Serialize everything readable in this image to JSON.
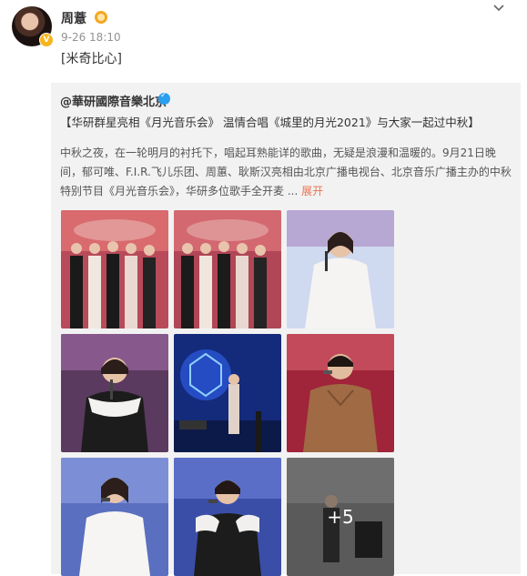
{
  "post": {
    "author": "周薏",
    "timestamp": "9-26 18:10",
    "text": "[米奇比心]"
  },
  "repost": {
    "author": "@華研國際音樂北京",
    "headline": "【华研群星亮相《月光音乐会》 温情合唱《城里的月光2021》与大家一起过中秋】",
    "body_text": "中秋之夜，在一轮明月的衬托下，唱起耳熟能详的歌曲，无疑是浪漫和温暖的。9月21日晚间，郁可唯、F.I.R.飞儿乐团、周蕙、耿斯汉亮相由北京广播电视台、北京音乐广播主办的中秋特别节目《月光音乐会》，华研多位歌手全开麦 ...",
    "expand_label": "展开",
    "more_photos_count": "+5"
  },
  "icons": {
    "dropdown": "chevron-down-icon",
    "verified_user": "yellow-verified-icon",
    "verified_org": "blue-verified-icon"
  },
  "colors": {
    "link": "#eb7350",
    "repost_bg": "#f2f2f2",
    "org_badge": "#2a9ff0",
    "user_badge": "#f5a623"
  }
}
